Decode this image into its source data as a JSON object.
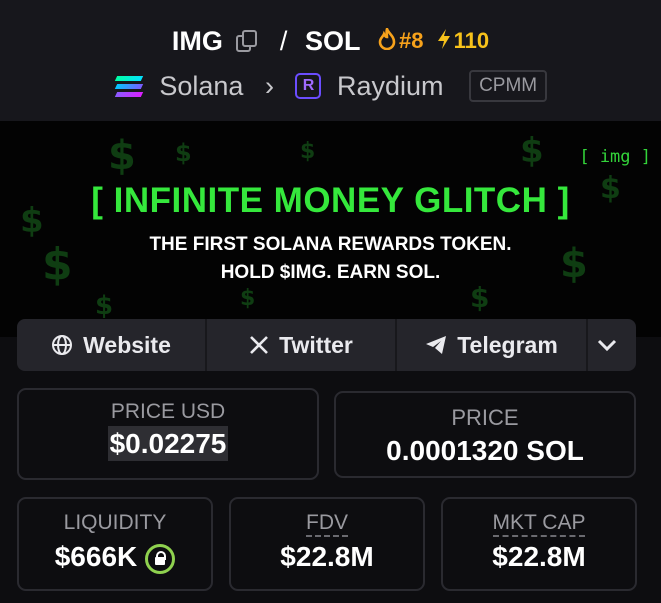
{
  "pair": {
    "base": "IMG",
    "separator": "/",
    "quote": "SOL",
    "rank": "#8",
    "boosts": "110"
  },
  "route": {
    "chain": "Solana",
    "dex": "Raydium",
    "pool_type": "CPMM"
  },
  "banner": {
    "tag": "[ img ]",
    "title": "[ INFINITE MONEY GLITCH ]",
    "line1": "THE FIRST SOLANA REWARDS TOKEN.",
    "line2": "HOLD $IMG. EARN SOL."
  },
  "links": {
    "website": "Website",
    "twitter": "Twitter",
    "telegram": "Telegram"
  },
  "stats": {
    "price_usd_label": "PRICE USD",
    "price_usd": "$0.02275",
    "price_label": "PRICE",
    "price": "0.0001320 SOL",
    "liquidity_label": "LIQUIDITY",
    "liquidity": "$666K",
    "fdv_label": "FDV",
    "fdv": "$22.8M",
    "mktcap_label": "MKT CAP",
    "mktcap": "$22.8M"
  },
  "colors": {
    "accent_green": "#35e83c",
    "rank_orange": "#f7a21b",
    "lock_green": "#8fd14f",
    "background": "#0d0d10"
  }
}
